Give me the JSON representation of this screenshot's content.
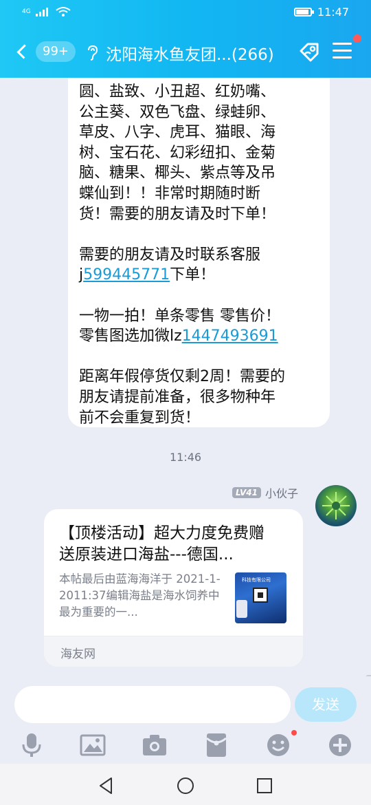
{
  "status_bar": {
    "network_label": "4G",
    "time": "11:47"
  },
  "header": {
    "unread_count": "99+",
    "title": "沈阳海水鱼友团...(266)"
  },
  "messages": [
    {
      "type": "text",
      "paragraphs": [
        {
          "parts": [
            {
              "text": "圆、盐致、小丑超、红奶嘴、\n公主葵、双色飞盘、绿蛙卵、\n草皮、八字、虎耳、猫眼、海\n树、宝石花、幻彩纽扣、金菊\n脑、糖果、椰头、紫点等及吊\n蝶仙到！！非常时期随时断\n货！需要的朋友请及时下单！",
              "link": false
            }
          ]
        },
        {
          "parts": [
            {
              "text": "需要的朋友请及时联系客服\nj",
              "link": false
            },
            {
              "text": "599445771",
              "link": true
            },
            {
              "text": "下单！",
              "link": false
            }
          ]
        },
        {
          "parts": [
            {
              "text": "一物一拍！单条零售 零售价！\n零售图选加微lz",
              "link": false
            },
            {
              "text": "1447493691",
              "link": true
            }
          ]
        },
        {
          "parts": [
            {
              "text": "距离年假停货仅剩2周！需要的\n朋友请提前准备，很多物种年\n前不会重复到货！",
              "link": false
            }
          ]
        }
      ]
    }
  ],
  "timestamp": "11:46",
  "sender": {
    "level": "LV41",
    "name": "小伙子"
  },
  "share_card": {
    "title": "【顶楼活动】超大力度免费赠送原装进口海盐---德国...",
    "description": "本帖最后由蓝海海洋于 2021-1-2011:37编辑海盐是海水饲养中最为重要的一...",
    "thumbnail_caption": "科技有限公司",
    "source": "海友网"
  },
  "input": {
    "value": "",
    "placeholder": "",
    "send_label": "发送"
  },
  "toolbar_icons": [
    "mic-icon",
    "image-icon",
    "camera-icon",
    "red-packet-icon",
    "emoji-icon",
    "plus-icon"
  ],
  "colors": {
    "header_gradient_start": "#1fc8f5",
    "header_gradient_end": "#1aa7f0",
    "link": "#1a9bd6",
    "send_button": "#b8e6fa",
    "notification_dot": "#ff5a5a"
  }
}
